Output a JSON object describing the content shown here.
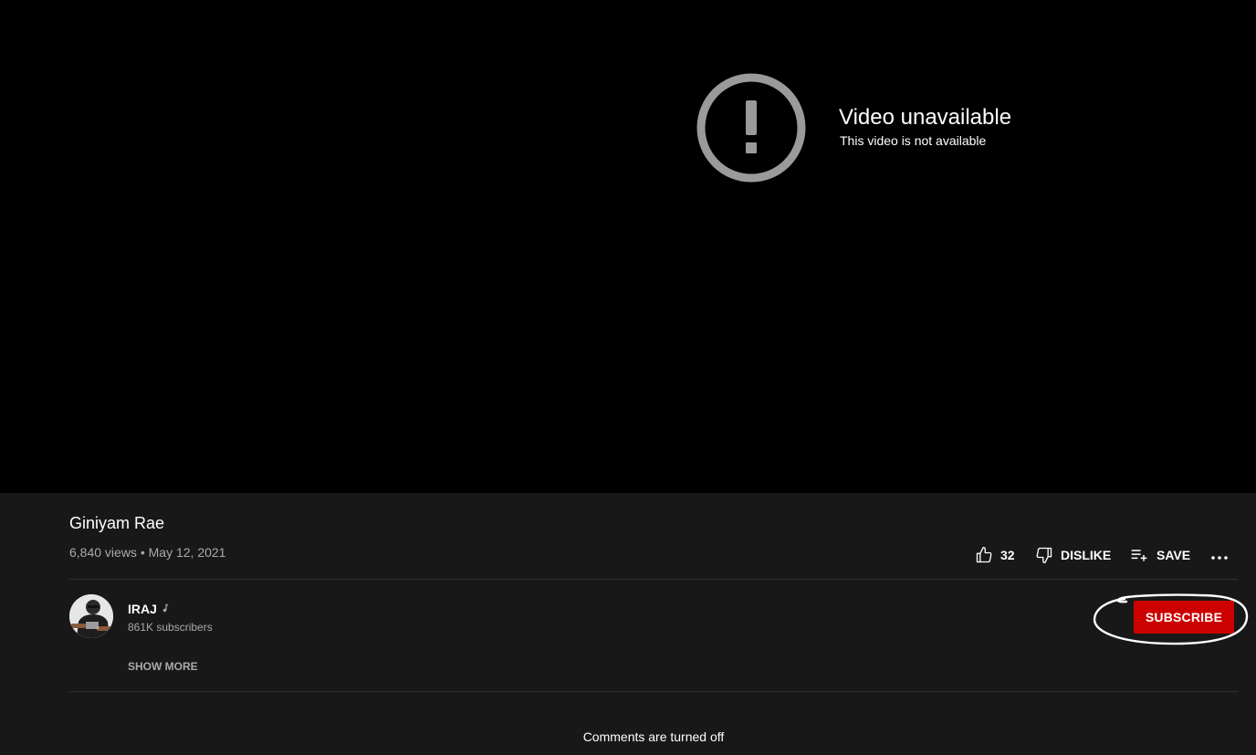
{
  "player": {
    "error_title": "Video unavailable",
    "error_subtitle": "This video is not available"
  },
  "video": {
    "title": "Giniyam Rae",
    "views": "6,840 views",
    "separator": "•",
    "date": "May 12, 2021"
  },
  "actions": {
    "like_count": "32",
    "dislike_label": "DISLIKE",
    "save_label": "SAVE"
  },
  "channel": {
    "name": "IRAJ",
    "subscribers": "861K subscribers",
    "subscribe_label": "SUBSCRIBE",
    "show_more_label": "SHOW MORE"
  },
  "comments": {
    "status": "Comments are turned off"
  },
  "colors": {
    "subscribe_red": "#cc0000",
    "page_bg": "#181818",
    "player_bg": "#000000",
    "secondary_text": "#aaaaaa"
  }
}
